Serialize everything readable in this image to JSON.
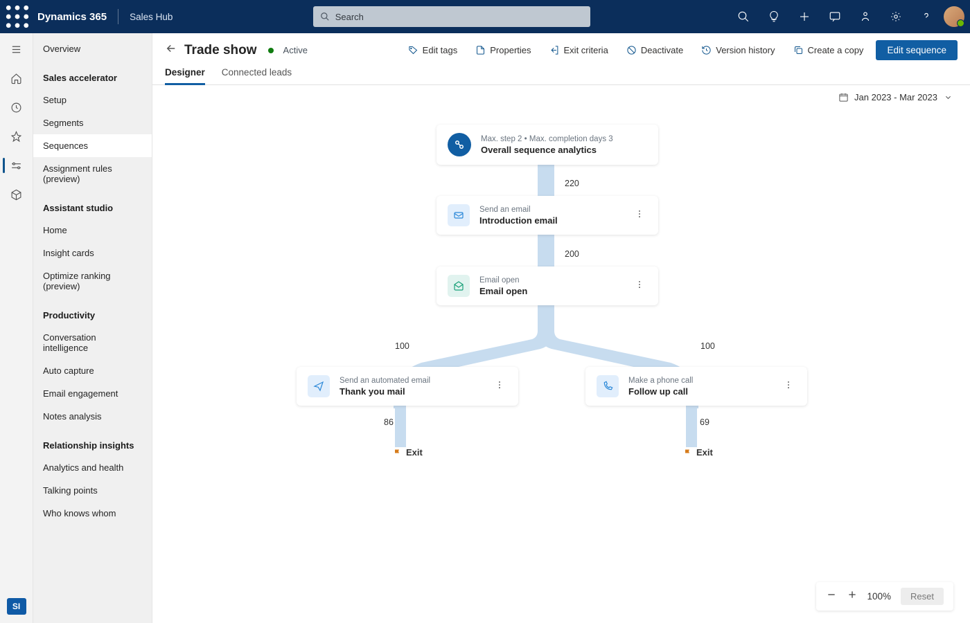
{
  "topbar": {
    "brand": "Dynamics 365",
    "hub": "Sales Hub",
    "search_placeholder": "Search"
  },
  "nav": {
    "overview": "Overview",
    "sections": [
      {
        "header": "Sales accelerator",
        "items": [
          "Setup",
          "Segments",
          "Sequences",
          "Assignment rules (preview)"
        ],
        "selected": "Sequences"
      },
      {
        "header": "Assistant studio",
        "items": [
          "Home",
          "Insight cards",
          "Optimize ranking (preview)"
        ]
      },
      {
        "header": "Productivity",
        "items": [
          "Conversation intelligence",
          "Auto capture",
          "Email engagement",
          "Notes analysis"
        ]
      },
      {
        "header": "Relationship insights",
        "items": [
          "Analytics and health",
          "Talking points",
          "Who knows whom"
        ]
      }
    ]
  },
  "page": {
    "title": "Trade show",
    "status": "Active",
    "actions": {
      "edit_tags": "Edit tags",
      "properties": "Properties",
      "exit_criteria": "Exit criteria",
      "deactivate": "Deactivate",
      "version_history": "Version history",
      "create_copy": "Create a copy",
      "edit_sequence": "Edit sequence"
    },
    "tabs": {
      "designer": "Designer",
      "connected_leads": "Connected leads",
      "active": "designer"
    },
    "date_range": "Jan 2023 - Mar 2023"
  },
  "flow": {
    "root_meta": "Max. step 2 • Max. completion days 3",
    "root_title": "Overall sequence analytics",
    "edge1": "220",
    "step1_meta": "Send an email",
    "step1_title": "Introduction email",
    "edge2": "200",
    "step2_meta": "Email open",
    "step2_title": "Email open",
    "left_count": "100",
    "right_count": "100",
    "left_meta": "Send an automated email",
    "left_title": "Thank you mail",
    "right_meta": "Make a phone call",
    "right_title": "Follow up call",
    "left_exit_count": "86",
    "right_exit_count": "69",
    "exit_label": "Exit"
  },
  "zoom": {
    "level": "100%",
    "reset": "Reset"
  },
  "rail_badge": "SI"
}
